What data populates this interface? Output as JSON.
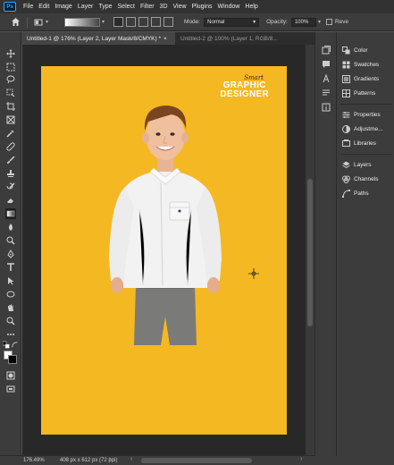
{
  "app": {
    "logo_text": "Ps"
  },
  "menu": [
    "File",
    "Edit",
    "Image",
    "Layer",
    "Type",
    "Select",
    "Filter",
    "3D",
    "View",
    "Plugins",
    "Window",
    "Help"
  ],
  "options_bar": {
    "mode_label": "Mode:",
    "mode_value": "Normal",
    "opacity_label": "Opacity:",
    "opacity_value": "100%",
    "reverse_label": "Reve"
  },
  "tabs": [
    {
      "label": "Untitled-1 @ 176% (Layer 2, Layer Mask/8/CMYK) *",
      "close": "×",
      "active": true
    },
    {
      "label": "Untitled-2 @ 100% (Layer 1, RGB/8...",
      "close": "",
      "active": false
    }
  ],
  "artboard": {
    "background_color": "#f4b822",
    "logo_script": "Smart",
    "logo_line1": "GRAPHIC",
    "logo_line2": "DESIGNER"
  },
  "status": {
    "zoom": "176.49%",
    "doc_info": "408 px x 612 px (72 ppi)"
  },
  "panels": [
    {
      "label": "Color",
      "icon": "color-wheel-icon"
    },
    {
      "label": "Swatches",
      "icon": "swatches-icon"
    },
    {
      "label": "Gradients",
      "icon": "gradients-icon"
    },
    {
      "label": "Patterns",
      "icon": "patterns-icon"
    },
    {
      "label": "Properties",
      "icon": "properties-icon"
    },
    {
      "label": "Adjustme...",
      "icon": "adjustments-icon"
    },
    {
      "label": "Libraries",
      "icon": "libraries-icon"
    },
    {
      "label": "Layers",
      "icon": "layers-icon"
    },
    {
      "label": "Channels",
      "icon": "channels-icon"
    },
    {
      "label": "Paths",
      "icon": "paths-icon"
    }
  ],
  "colors": {
    "accent": "#31a8ff",
    "canvas_yellow": "#f4b822",
    "ui_dark": "#323232"
  }
}
